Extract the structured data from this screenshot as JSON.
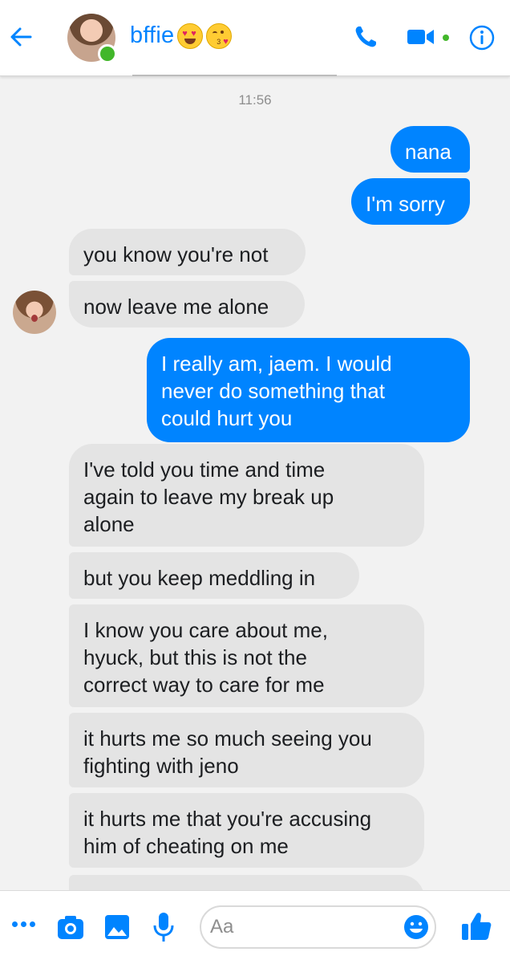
{
  "header": {
    "contact_name": "bffie",
    "name_emoji": [
      "heart-eyes-emoji",
      "kiss-emoji"
    ],
    "icons": [
      "back-arrow-icon",
      "phone-icon",
      "video-camera-icon",
      "info-icon"
    ],
    "active_status": "online"
  },
  "thread": {
    "timestamp": "11:56",
    "messages": [
      {
        "from": "me",
        "text": "nana"
      },
      {
        "from": "me",
        "text": "I'm sorry"
      },
      {
        "from": "them",
        "text": "you know you're not"
      },
      {
        "from": "them",
        "text": "now leave me alone"
      },
      {
        "from": "me",
        "text": "I really am, jaem. I would\nnever do something that\ncould hurt you"
      },
      {
        "from": "them",
        "text": "I've told you time and time\nagain to leave my break up\nalone"
      },
      {
        "from": "them",
        "text": "but you keep meddling in"
      },
      {
        "from": "them",
        "text": "I know you care about me,\nhyuck, but this is not the\ncorrect way to care for me"
      },
      {
        "from": "them",
        "text": "it hurts me so much seeing you\nfighting with jeno"
      },
      {
        "from": "them",
        "text": "it hurts me that you're accusing\nhim of cheating on me"
      }
    ]
  },
  "composer": {
    "placeholder": "Aa",
    "icons": [
      "more-icon",
      "camera-icon",
      "image-icon",
      "microphone-icon",
      "emoji-icon",
      "thumbs-up-icon"
    ]
  },
  "colors": {
    "accent": "#0084ff",
    "incoming_bubble": "#e4e4e4",
    "thread_background": "#f2f2f2",
    "online": "#42b72a"
  }
}
